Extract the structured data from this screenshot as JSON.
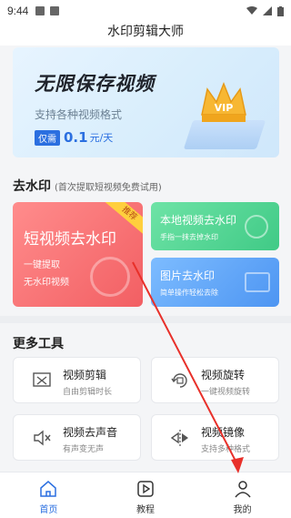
{
  "status_bar": {
    "time": "9:44"
  },
  "app": {
    "title": "水印剪辑大师"
  },
  "banner": {
    "headline": "无限保存视频",
    "subtitle": "支持各种视频格式",
    "price_tag": "仅需",
    "price": "0.1",
    "price_unit": "元/天",
    "badge": "VIP"
  },
  "watermark_section": {
    "title": "去水印",
    "note": "(首次提取短视频免费试用)",
    "short_video": {
      "title": "短视频去水印",
      "ribbon": "推荐",
      "line1": "一键提取",
      "line2": "无水印视频"
    },
    "local_video": {
      "title": "本地视频去水印",
      "desc": "手指一抹去掉水印"
    },
    "image": {
      "title": "图片去水印",
      "desc": "简单操作轻松去除"
    }
  },
  "tools_section": {
    "title": "更多工具",
    "items": [
      {
        "title": "视频剪辑",
        "desc": "自由剪辑时长",
        "icon": "scissors-icon"
      },
      {
        "title": "视频旋转",
        "desc": "一键视频旋转",
        "icon": "rotate-icon"
      },
      {
        "title": "视频去声音",
        "desc": "有声变无声",
        "icon": "mute-icon"
      },
      {
        "title": "视频镜像",
        "desc": "支持多种格式",
        "icon": "mirror-icon"
      }
    ]
  },
  "tab_bar": {
    "items": [
      {
        "label": "首页",
        "icon": "home-icon",
        "active": true
      },
      {
        "label": "教程",
        "icon": "play-icon",
        "active": false
      },
      {
        "label": "我的",
        "icon": "user-icon",
        "active": false
      }
    ]
  },
  "colors": {
    "accent": "#2b6fe0",
    "red_card": "#f25f63",
    "green_card": "#40ca86",
    "blue_card": "#4d95f2",
    "annotation_arrow": "#e8302a"
  }
}
